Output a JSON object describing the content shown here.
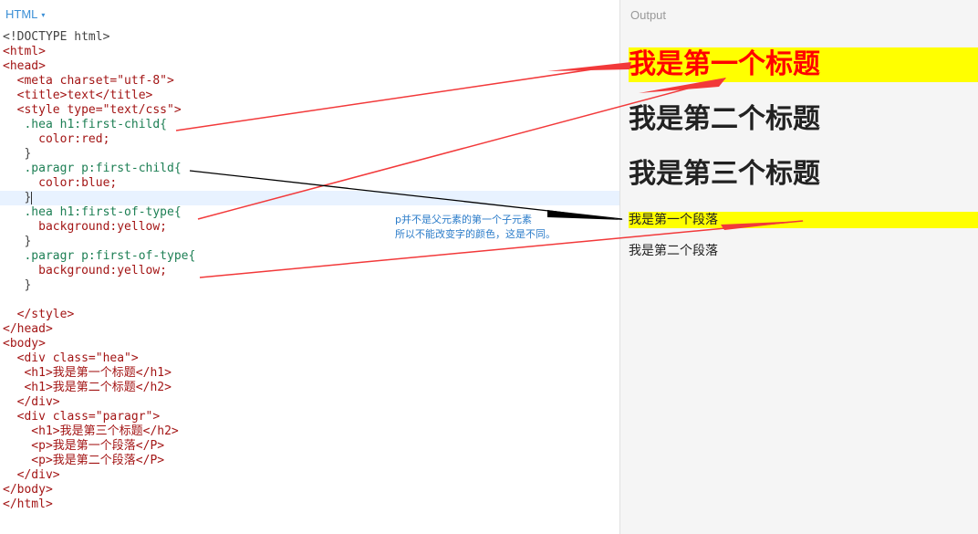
{
  "editor": {
    "lang_tab": "HTML",
    "lines": [
      "<!DOCTYPE html>",
      "<html>",
      "<head>",
      "  <meta charset=\"utf-8\">",
      "  <title>text</title>",
      "  <style type=\"text/css\">",
      "   .hea h1:first-child{",
      "     color:red;",
      "   }",
      "   .paragr p:first-child{",
      "     color:blue;",
      "   }",
      "   .hea h1:first-of-type{",
      "     background:yellow;",
      "   }",
      "   .paragr p:first-of-type{",
      "     background:yellow;",
      "   }",
      "",
      "  </style>",
      "</head>",
      "<body>",
      "  <div class=\"hea\">",
      "   <h1>我是第一个标题</h1>",
      "   <h1>我是第二个标题</h2>",
      "  </div>",
      "  <div class=\"paragr\">",
      "    <h1>我是第三个标题</h2>",
      "    <p>我是第一个段落</P>",
      "    <p>我是第二个段落</P>",
      "  </div>",
      "</body>",
      "</html>"
    ]
  },
  "output": {
    "title": "Output",
    "h1_first": "我是第一个标题",
    "h1_second": "我是第二个标题",
    "h1_third": "我是第三个标题",
    "p_first": "我是第一个段落",
    "p_second": "我是第二个段落"
  },
  "annotation": {
    "line1": "p并不是父元素的第一个子元素",
    "line2": "所以不能改变字的颜色，这是不同。"
  },
  "colors": {
    "red_arrow": "#f2393a",
    "black_arrow": "#000000",
    "highlight": "#ffff00",
    "link_blue": "#3b8fd6"
  }
}
